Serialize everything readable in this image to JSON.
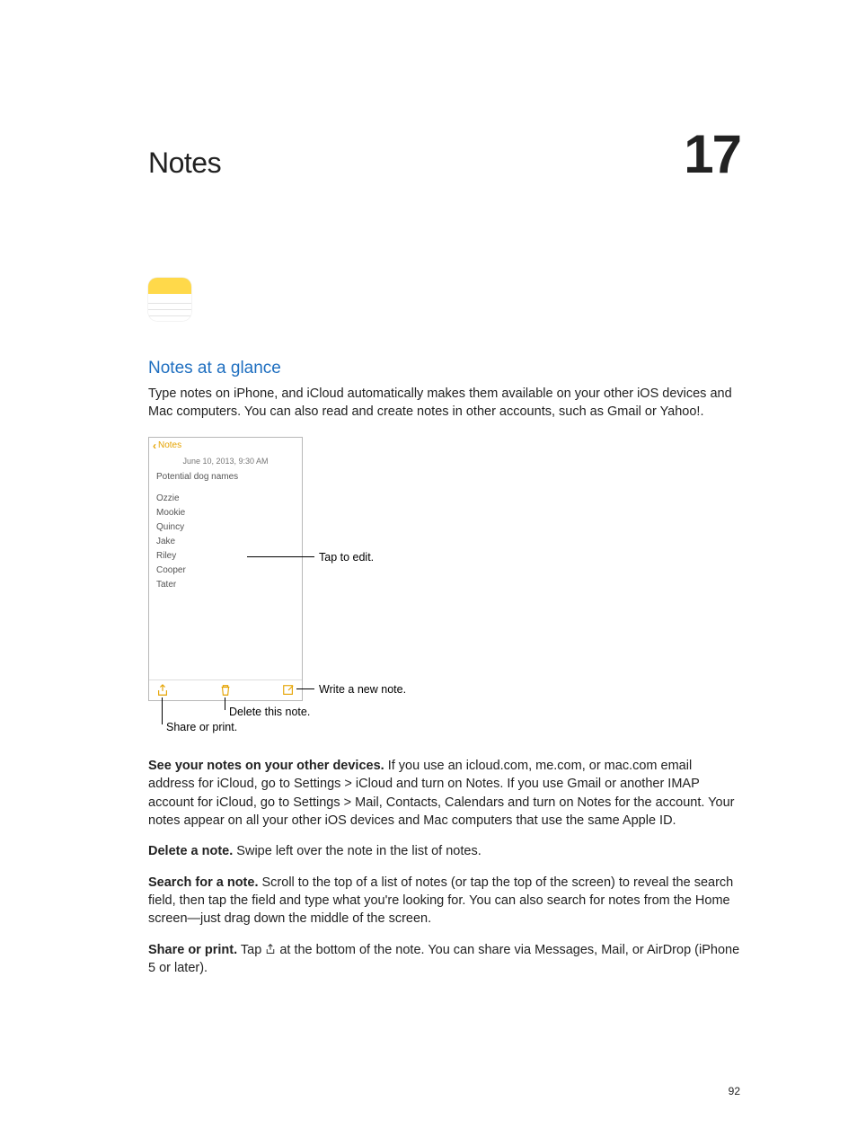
{
  "chapter": {
    "title": "Notes",
    "number": "17"
  },
  "section": {
    "title": "Notes at a glance"
  },
  "intro": "Type notes on iPhone, and iCloud automatically makes them available on your other iOS devices and Mac computers. You can also read and create notes in other accounts, such as Gmail or Yahoo!.",
  "screenshot": {
    "back_label": "Notes",
    "date": "June 10, 2013, 9:30 AM",
    "note_title": "Potential dog names",
    "items": [
      "Ozzie",
      "Mookie",
      "Quincy",
      "Jake",
      "Riley",
      "Cooper",
      "Tater"
    ]
  },
  "callouts": {
    "tap_to_edit": "Tap to edit.",
    "write_new": "Write a new note.",
    "delete_this": "Delete this note.",
    "share_print": "Share or print."
  },
  "paragraphs": {
    "see_devices_lead": "See your notes on your other devices.",
    "see_devices_body": " If you use an icloud.com, me.com, or mac.com email address for iCloud, go to Settings > iCloud and turn on Notes. If you use Gmail or another IMAP account for iCloud, go to Settings > Mail, Contacts, Calendars and turn on Notes for the account. Your notes appear on all your other iOS devices and Mac computers that use the same Apple ID.",
    "delete_lead": "Delete a note.",
    "delete_body": " Swipe left over the note in the list of notes.",
    "search_lead": "Search for a note.",
    "search_body": " Scroll to the top of a list of notes (or tap the top of the screen) to reveal the search field, then tap the field and type what you're looking for. You can also search for notes from the Home screen—just drag down the middle of the screen.",
    "share_lead": "Share or print.",
    "share_body_before": " Tap ",
    "share_body_after": " at the bottom of the note. You can share via Messages, Mail, or AirDrop (iPhone 5 or later)."
  },
  "page_number": "92"
}
